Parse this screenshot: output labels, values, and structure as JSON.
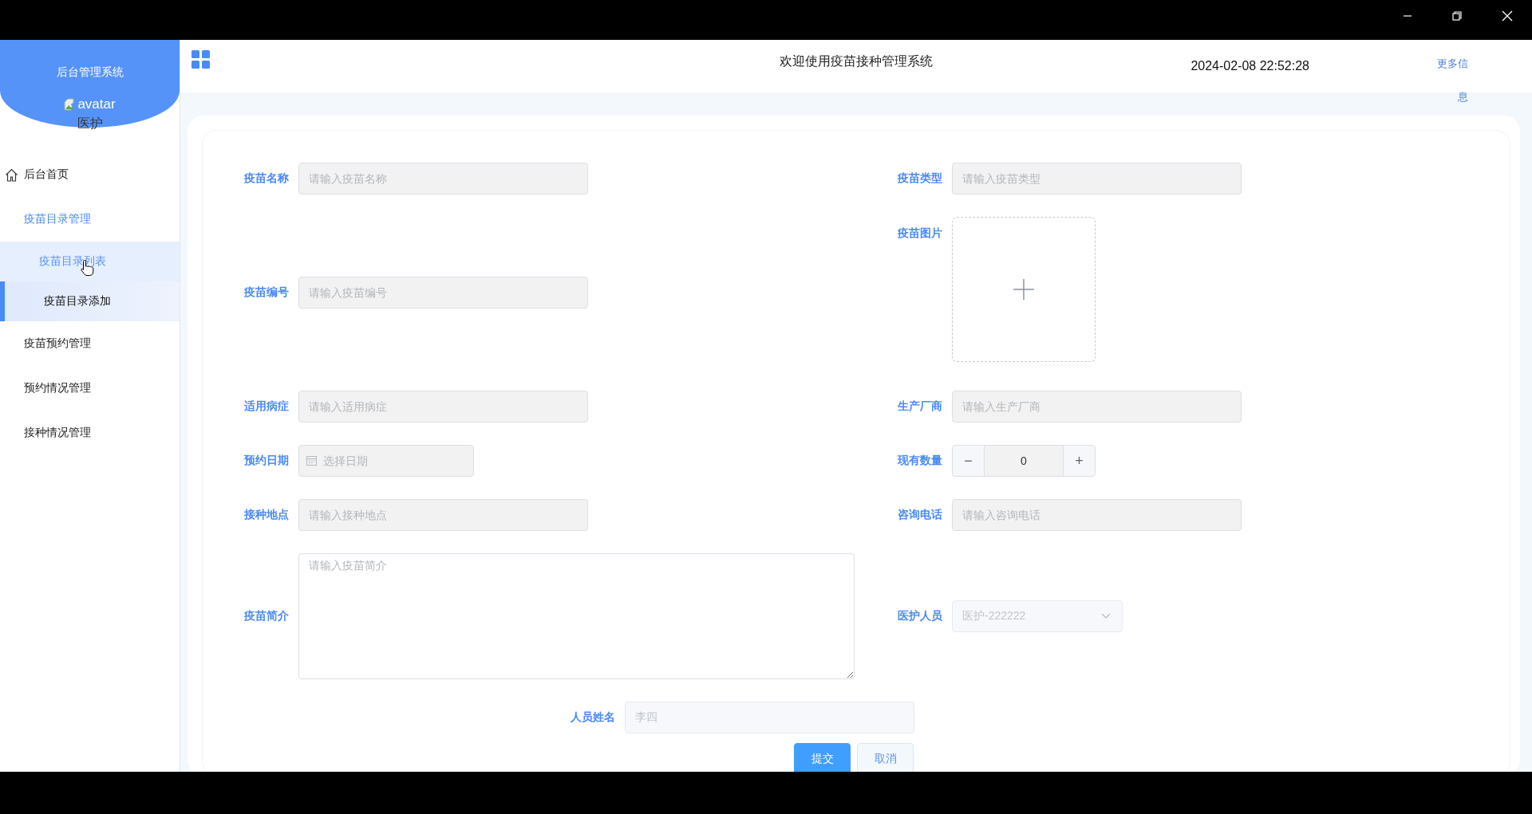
{
  "sidebar": {
    "title": "后台管理系统",
    "avatar_alt": "avatar",
    "role": "医护",
    "menu": [
      {
        "label": "后台首页",
        "kind": "home"
      },
      {
        "label": "疫苗目录管理",
        "kind": "group",
        "expanded": true,
        "children": [
          {
            "label": "疫苗目录列表",
            "selected": false,
            "hovered": true
          },
          {
            "label": "疫苗目录添加",
            "selected": true,
            "hovered": false
          }
        ]
      },
      {
        "label": "疫苗预约管理",
        "kind": "group",
        "expanded": false
      },
      {
        "label": "预约情况管理",
        "kind": "group",
        "expanded": false
      },
      {
        "label": "接种情况管理",
        "kind": "group",
        "expanded": false
      }
    ]
  },
  "header": {
    "title": "欢迎使用疫苗接种管理系统",
    "datetime": "2024-02-08 22:52:28",
    "more_link": "更多信息"
  },
  "form": {
    "rows": [
      [
        {
          "label": "疫苗名称",
          "kind": "text",
          "placeholder": "请输入疫苗名称"
        },
        {
          "label": "疫苗类型",
          "kind": "text",
          "placeholder": "请输入疫苗类型"
        }
      ],
      [
        {
          "label": "疫苗编号",
          "kind": "text",
          "placeholder": "请输入疫苗编号"
        },
        {
          "label": "疫苗图片",
          "kind": "upload"
        }
      ],
      [
        {
          "label": "适用病症",
          "kind": "text",
          "placeholder": "请输入适用病症"
        },
        {
          "label": "生产厂商",
          "kind": "text",
          "placeholder": "请输入生产厂商"
        }
      ],
      [
        {
          "label": "预约日期",
          "kind": "date",
          "placeholder": "选择日期"
        },
        {
          "label": "现有数量",
          "kind": "number",
          "value": "0",
          "decrement": "−",
          "increment": "+"
        }
      ],
      [
        {
          "label": "接种地点",
          "kind": "text",
          "placeholder": "请输入接种地点"
        },
        {
          "label": "咨询电话",
          "kind": "text",
          "placeholder": "请输入咨询电话"
        }
      ],
      [
        {
          "label": "疫苗简介",
          "kind": "textarea",
          "placeholder": "请输入疫苗简介"
        },
        {
          "label": "医护人员",
          "kind": "select",
          "value": "医护-222222",
          "disabled": true
        }
      ],
      [
        {
          "label": "人员姓名",
          "kind": "text",
          "value": "李四",
          "disabled": true
        }
      ]
    ],
    "buttons": [
      {
        "label": "提交",
        "kind": "primary"
      },
      {
        "label": "取消",
        "kind": "default"
      }
    ]
  }
}
